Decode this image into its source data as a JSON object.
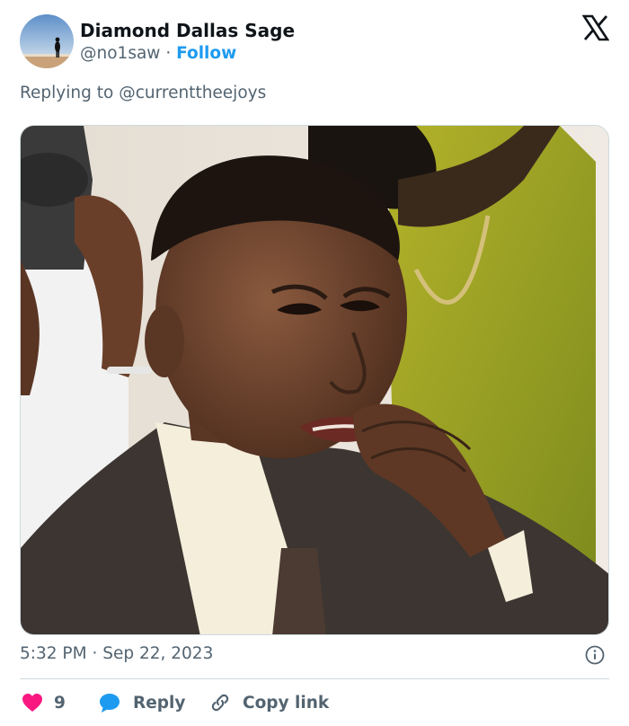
{
  "tweet": {
    "author": {
      "name": "Diamond Dallas Sage",
      "handle": "@no1saw",
      "separator": "·",
      "follow_label": "Follow"
    },
    "replying_prefix": "Replying to",
    "replying_to": "@currenttheejoys",
    "timestamp": {
      "time": "5:32 PM",
      "separator": "·",
      "date": "Sep 22, 2023"
    },
    "actions": {
      "like_count": "9",
      "reply_label": "Reply",
      "copy_label": "Copy link"
    }
  },
  "colors": {
    "accent": "#1d9bf0",
    "like": "#f91880",
    "muted": "#536471",
    "text": "#0f1419",
    "border": "#cfd9de"
  },
  "icons": [
    "x-logo-icon",
    "info-icon",
    "heart-icon",
    "reply-bubble-icon",
    "link-icon"
  ]
}
